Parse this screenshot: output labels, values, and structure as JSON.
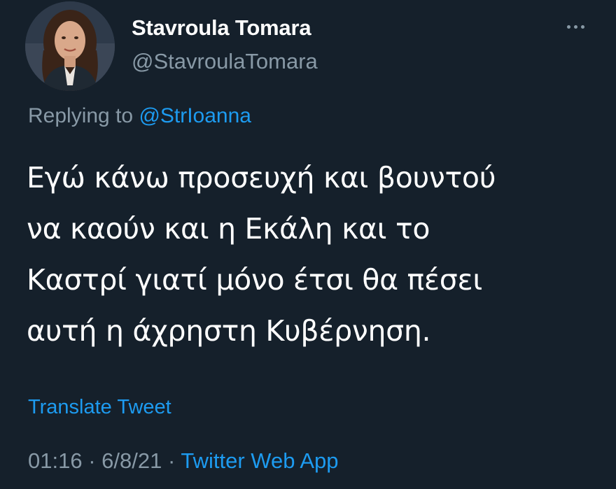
{
  "user": {
    "display_name": "Stavroula Tomara",
    "handle": "@StavroulaTomara",
    "avatar": "profile-photo"
  },
  "more_menu": {
    "icon": "more-horizontal-icon"
  },
  "reply": {
    "prefix": "Replying to",
    "mention": "@StrIoanna"
  },
  "tweet": {
    "lines": [
      "Εγώ κάνω προσευχή και βουντού",
      "να καούν και η Εκάλη και το",
      "Καστρί γιατί μόνο έτσι θα πέσει",
      "αυτή η άχρηστη Κυβέρνηση."
    ]
  },
  "translate_label": "Translate Tweet",
  "meta": {
    "time": "01:16",
    "separator": "·",
    "date": "6/8/21",
    "source": "Twitter Web App"
  },
  "colors": {
    "background": "#15202b",
    "text": "#ffffff",
    "secondary": "#8899a6",
    "link": "#1d9bf0"
  }
}
